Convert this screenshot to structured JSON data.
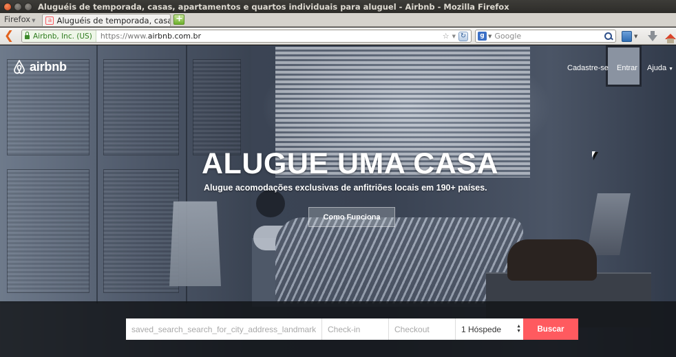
{
  "window": {
    "title": "Aluguéis de temporada, casas, apartamentos e quartos individuais para aluguel - Airbnb - Mozilla Firefox"
  },
  "browser": {
    "menu_label": "Firefox",
    "tab_title": "Aluguéis de temporada, casas,...",
    "identity": "Airbnb, Inc. (US)",
    "url_scheme": "https://www.",
    "url_host": "airbnb.com.br",
    "search_engine": "Google",
    "search_placeholder": "Google"
  },
  "site": {
    "logo_text": "airbnb",
    "nav": {
      "signup": "Cadastre-se",
      "login": "Entrar",
      "help": "Ajuda"
    },
    "hero": {
      "title": "ALUGUE UMA CASA",
      "subtitle": "Alugue acomodações exclusivas de anfitriões locais em 190+ países.",
      "how_it_works": "Como Funciona"
    },
    "search": {
      "where_placeholder": "saved_search_search_for_city_address_landmark",
      "checkin_placeholder": "Check-in",
      "checkout_placeholder": "Checkout",
      "guests_value": "1 Hóspede",
      "submit": "Buscar"
    }
  },
  "colors": {
    "brand": "#ff5a5f",
    "secure_green": "#2b7a1b"
  }
}
